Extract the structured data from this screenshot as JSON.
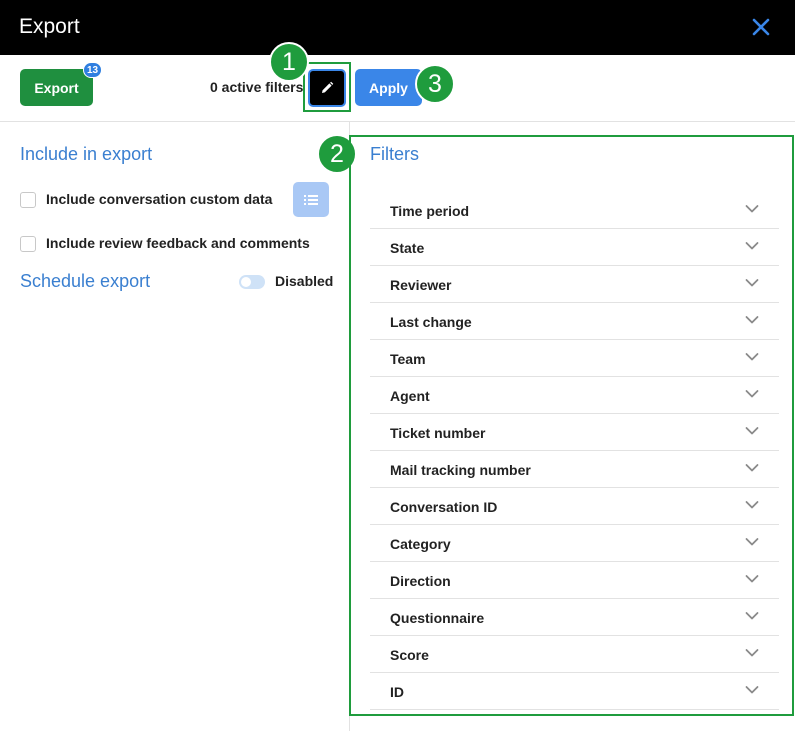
{
  "window": {
    "title": "Export",
    "close_icon": "close-icon"
  },
  "toolbar": {
    "export_label": "Export",
    "export_badge": "13",
    "active_filters": "0 active filters",
    "edit_icon": "pencil-icon",
    "apply_label": "Apply"
  },
  "callouts": [
    "1",
    "2",
    "3"
  ],
  "include": {
    "title": "Include in export",
    "options": [
      {
        "label": "Include conversation custom data",
        "checked": false
      },
      {
        "label": "Include review feedback and comments",
        "checked": false
      }
    ],
    "list_icon": "list-icon"
  },
  "schedule": {
    "title": "Schedule export",
    "toggle_on": false,
    "toggle_label": "Disabled"
  },
  "filters": {
    "title": "Filters",
    "items": [
      "Time period",
      "State",
      "Reviewer",
      "Last change",
      "Team",
      "Agent",
      "Ticket number",
      "Mail tracking number",
      "Conversation ID",
      "Category",
      "Direction",
      "Questionnaire",
      "Score",
      "ID"
    ]
  },
  "colors": {
    "accent_blue": "#3a86e8",
    "export_green": "#1f8f3f",
    "callout_green": "#1f9c3d",
    "section_title_blue": "#3a7fd0"
  }
}
